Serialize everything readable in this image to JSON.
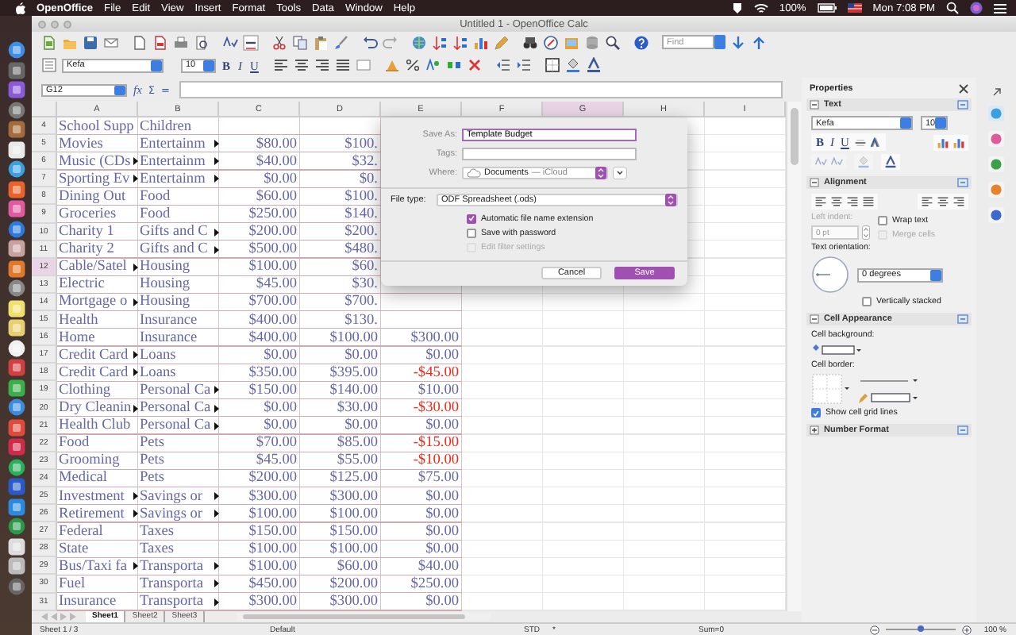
{
  "menu_bar": {
    "app": "OpenOffice",
    "menus": [
      "File",
      "Edit",
      "View",
      "Insert",
      "Format",
      "Tools",
      "Data",
      "Window",
      "Help"
    ],
    "battery": "100%",
    "clock": "Mon 7:08 PM"
  },
  "window": {
    "title": "Untitled 1 - OpenOffice Calc"
  },
  "toolbar": {
    "find": {
      "placeholder": "Find"
    },
    "font": "Kefa",
    "size": "10",
    "format_buttons": [
      "B",
      "I",
      "U"
    ]
  },
  "formula_bar": {
    "cell_ref": "G12",
    "buttons": [
      "fx",
      "Σ",
      "="
    ]
  },
  "sheet": {
    "columns": [
      {
        "label": "A",
        "selected": false
      },
      {
        "label": "B",
        "selected": false
      },
      {
        "label": "C",
        "selected": false
      },
      {
        "label": "D",
        "selected": false
      },
      {
        "label": "E",
        "selected": false
      },
      {
        "label": "F",
        "selected": false
      },
      {
        "label": "G",
        "selected": true
      },
      {
        "label": "H",
        "selected": false
      },
      {
        "label": "I",
        "selected": false
      }
    ],
    "rows": [
      {
        "number": "4",
        "selected": false,
        "cells": [
          {
            "text": "School Supp",
            "clipped": false
          },
          {
            "text": "Children",
            "clipped": false
          }
        ]
      },
      {
        "number": "5",
        "selected": false,
        "cells": [
          {
            "text": "Movies",
            "clipped": false
          },
          {
            "text": "Entertainm",
            "clipped": true
          },
          {
            "text": "$80.00"
          },
          {
            "text": "$100."
          }
        ]
      },
      {
        "number": "6",
        "selected": false,
        "cells": [
          {
            "text": "Music (CDs",
            "clipped": true
          },
          {
            "text": "Entertainm",
            "clipped": true
          },
          {
            "text": "$40.00"
          },
          {
            "text": "$32."
          }
        ]
      },
      {
        "number": "7",
        "selected": false,
        "cells": [
          {
            "text": "Sporting Ev",
            "clipped": true
          },
          {
            "text": "Entertainm",
            "clipped": true
          },
          {
            "text": "$0.00"
          },
          {
            "text": "$0."
          }
        ]
      },
      {
        "number": "8",
        "selected": false,
        "cells": [
          {
            "text": "Dining Out",
            "clipped": false
          },
          {
            "text": "Food",
            "clipped": false
          },
          {
            "text": "$60.00"
          },
          {
            "text": "$100."
          }
        ]
      },
      {
        "number": "9",
        "selected": false,
        "cells": [
          {
            "text": "Groceries",
            "clipped": false
          },
          {
            "text": "Food",
            "clipped": false
          },
          {
            "text": "$250.00"
          },
          {
            "text": "$140."
          }
        ]
      },
      {
        "number": "10",
        "selected": false,
        "cells": [
          {
            "text": "Charity 1",
            "clipped": false
          },
          {
            "text": "Gifts and C",
            "clipped": true
          },
          {
            "text": "$200.00"
          },
          {
            "text": "$200."
          }
        ]
      },
      {
        "number": "11",
        "selected": false,
        "cells": [
          {
            "text": "Charity 2",
            "clipped": false
          },
          {
            "text": "Gifts and C",
            "clipped": true
          },
          {
            "text": "$500.00"
          },
          {
            "text": "$480."
          }
        ]
      },
      {
        "number": "12",
        "selected": true,
        "cells": [
          {
            "text": "Cable/Satel",
            "clipped": true
          },
          {
            "text": "Housing",
            "clipped": false
          },
          {
            "text": "$100.00"
          },
          {
            "text": "$60."
          }
        ]
      },
      {
        "number": "13",
        "selected": false,
        "cells": [
          {
            "text": "Electric",
            "clipped": false
          },
          {
            "text": "Housing",
            "clipped": false
          },
          {
            "text": "$45.00"
          },
          {
            "text": "$30."
          }
        ]
      },
      {
        "number": "14",
        "selected": false,
        "cells": [
          {
            "text": "Mortgage o",
            "clipped": true
          },
          {
            "text": "Housing",
            "clipped": false
          },
          {
            "text": "$700.00"
          },
          {
            "text": "$700."
          }
        ]
      },
      {
        "number": "15",
        "selected": false,
        "cells": [
          {
            "text": "Health",
            "clipped": false
          },
          {
            "text": "Insurance",
            "clipped": false
          },
          {
            "text": "$400.00"
          },
          {
            "text": "$130."
          }
        ]
      },
      {
        "number": "16",
        "selected": false,
        "cells": [
          {
            "text": "Home",
            "clipped": false
          },
          {
            "text": "Insurance",
            "clipped": false
          },
          {
            "text": "$400.00"
          },
          {
            "text": "$100.00"
          },
          {
            "text": "$300.00",
            "negative": false
          }
        ]
      },
      {
        "number": "17",
        "selected": false,
        "cells": [
          {
            "text": "Credit Card",
            "clipped": true
          },
          {
            "text": "Loans",
            "clipped": false
          },
          {
            "text": "$0.00"
          },
          {
            "text": "$0.00"
          },
          {
            "text": "$0.00",
            "negative": false
          }
        ]
      },
      {
        "number": "18",
        "selected": false,
        "cells": [
          {
            "text": "Credit Card",
            "clipped": true
          },
          {
            "text": "Loans",
            "clipped": false
          },
          {
            "text": "$350.00"
          },
          {
            "text": "$395.00"
          },
          {
            "text": "-$45.00",
            "negative": true
          }
        ]
      },
      {
        "number": "19",
        "selected": false,
        "cells": [
          {
            "text": "Clothing",
            "clipped": false
          },
          {
            "text": "Personal Ca",
            "clipped": true
          },
          {
            "text": "$150.00"
          },
          {
            "text": "$140.00"
          },
          {
            "text": "$10.00",
            "negative": false
          }
        ]
      },
      {
        "number": "20",
        "selected": false,
        "cells": [
          {
            "text": "Dry Cleanin",
            "clipped": true
          },
          {
            "text": "Personal Ca",
            "clipped": true
          },
          {
            "text": "$0.00"
          },
          {
            "text": "$30.00"
          },
          {
            "text": "-$30.00",
            "negative": true
          }
        ]
      },
      {
        "number": "21",
        "selected": false,
        "cells": [
          {
            "text": "Health Club",
            "clipped": false
          },
          {
            "text": "Personal Ca",
            "clipped": true
          },
          {
            "text": "$0.00"
          },
          {
            "text": "$0.00"
          },
          {
            "text": "$0.00",
            "negative": false
          }
        ]
      },
      {
        "number": "22",
        "selected": false,
        "cells": [
          {
            "text": "Food",
            "clipped": false
          },
          {
            "text": "Pets",
            "clipped": false
          },
          {
            "text": "$70.00"
          },
          {
            "text": "$85.00"
          },
          {
            "text": "-$15.00",
            "negative": true
          }
        ]
      },
      {
        "number": "23",
        "selected": false,
        "cells": [
          {
            "text": "Grooming",
            "clipped": false
          },
          {
            "text": "Pets",
            "clipped": false
          },
          {
            "text": "$45.00"
          },
          {
            "text": "$55.00"
          },
          {
            "text": "-$10.00",
            "negative": true
          }
        ]
      },
      {
        "number": "24",
        "selected": false,
        "cells": [
          {
            "text": "Medical",
            "clipped": false
          },
          {
            "text": "Pets",
            "clipped": false
          },
          {
            "text": "$200.00"
          },
          {
            "text": "$125.00"
          },
          {
            "text": "$75.00",
            "negative": false
          }
        ]
      },
      {
        "number": "25",
        "selected": false,
        "cells": [
          {
            "text": "Investment",
            "clipped": true
          },
          {
            "text": "Savings or",
            "clipped": true
          },
          {
            "text": "$300.00"
          },
          {
            "text": "$300.00"
          },
          {
            "text": "$0.00",
            "negative": false
          }
        ]
      },
      {
        "number": "26",
        "selected": false,
        "cells": [
          {
            "text": "Retirement",
            "clipped": true
          },
          {
            "text": "Savings or",
            "clipped": true
          },
          {
            "text": "$100.00"
          },
          {
            "text": "$100.00"
          },
          {
            "text": "$0.00",
            "negative": false
          }
        ]
      },
      {
        "number": "27",
        "selected": false,
        "cells": [
          {
            "text": "Federal",
            "clipped": false
          },
          {
            "text": "Taxes",
            "clipped": false
          },
          {
            "text": "$150.00"
          },
          {
            "text": "$150.00"
          },
          {
            "text": "$0.00",
            "negative": false
          }
        ]
      },
      {
        "number": "28",
        "selected": false,
        "cells": [
          {
            "text": "State",
            "clipped": false
          },
          {
            "text": "Taxes",
            "clipped": false
          },
          {
            "text": "$100.00"
          },
          {
            "text": "$100.00"
          },
          {
            "text": "$0.00",
            "negative": false
          }
        ]
      },
      {
        "number": "29",
        "selected": false,
        "cells": [
          {
            "text": "Bus/Taxi fa",
            "clipped": true
          },
          {
            "text": "Transporta",
            "clipped": true
          },
          {
            "text": "$100.00"
          },
          {
            "text": "$60.00"
          },
          {
            "text": "$40.00",
            "negative": false
          }
        ]
      },
      {
        "number": "30",
        "selected": false,
        "cells": [
          {
            "text": "Fuel",
            "clipped": false
          },
          {
            "text": "Transporta",
            "clipped": true
          },
          {
            "text": "$450.00"
          },
          {
            "text": "$200.00"
          },
          {
            "text": "$250.00",
            "negative": false
          }
        ]
      },
      {
        "number": "31",
        "selected": false,
        "cells": [
          {
            "text": "Insurance",
            "clipped": false
          },
          {
            "text": "Transporta",
            "clipped": true
          },
          {
            "text": "$300.00"
          },
          {
            "text": "$300.00"
          },
          {
            "text": "$0.00",
            "negative": false
          }
        ]
      }
    ]
  },
  "sheet_tabs": [
    {
      "label": "Sheet1",
      "selected": true
    },
    {
      "label": "Sheet2",
      "selected": false
    },
    {
      "label": "Sheet3",
      "selected": false
    }
  ],
  "dialog": {
    "save_as": {
      "label": "Save As:",
      "value": "Template Budget"
    },
    "tags": {
      "label": "Tags:"
    },
    "where": {
      "label": "Where:",
      "location": "Documents",
      "service": "— iCloud"
    },
    "file_type": {
      "label": "File type:",
      "value": "ODF Spreadsheet (.ods)"
    },
    "options": [
      {
        "label": "Automatic file name extension",
        "checked": true,
        "disabled": false
      },
      {
        "label": "Save with password",
        "checked": false,
        "disabled": false
      },
      {
        "label": "Edit filter settings",
        "checked": false,
        "disabled": true
      }
    ],
    "buttons": [
      {
        "label": "Cancel",
        "default": false
      },
      {
        "label": "Save",
        "default": true
      }
    ]
  },
  "properties": {
    "title": "Properties",
    "text": {
      "title": "Text",
      "expanded": true,
      "font": "Kefa",
      "size": "10",
      "format_buttons": [
        "B",
        "I",
        "U"
      ]
    },
    "alignment": {
      "title": "Alignment",
      "expanded": true,
      "left_indent_label": "Left indent:",
      "left_indent": "0 pt",
      "wrap_text": {
        "label": "Wrap text",
        "checked": false,
        "disabled": false
      },
      "merge_cells": {
        "label": "Merge cells",
        "checked": false,
        "disabled": true
      },
      "orientation_label": "Text orientation:",
      "orientation": "0 degrees",
      "vertically_stacked": {
        "label": "Vertically stacked",
        "checked": false,
        "disabled": false
      }
    },
    "cell_appearance": {
      "title": "Cell Appearance",
      "expanded": true,
      "background_label": "Cell background:",
      "border_label": "Cell border:",
      "show_grid": {
        "label": "Show cell grid lines",
        "checked": true,
        "disabled": false
      }
    },
    "number_format": {
      "title": "Number Format",
      "expanded": false
    }
  },
  "status_bar": {
    "sheet": "Sheet 1 / 3",
    "style": "Default",
    "mode": "STD",
    "modified": "*",
    "sum": "Sum=0",
    "zoom": "100 %",
    "zoom_slider": {
      "level": 0.5
    }
  }
}
